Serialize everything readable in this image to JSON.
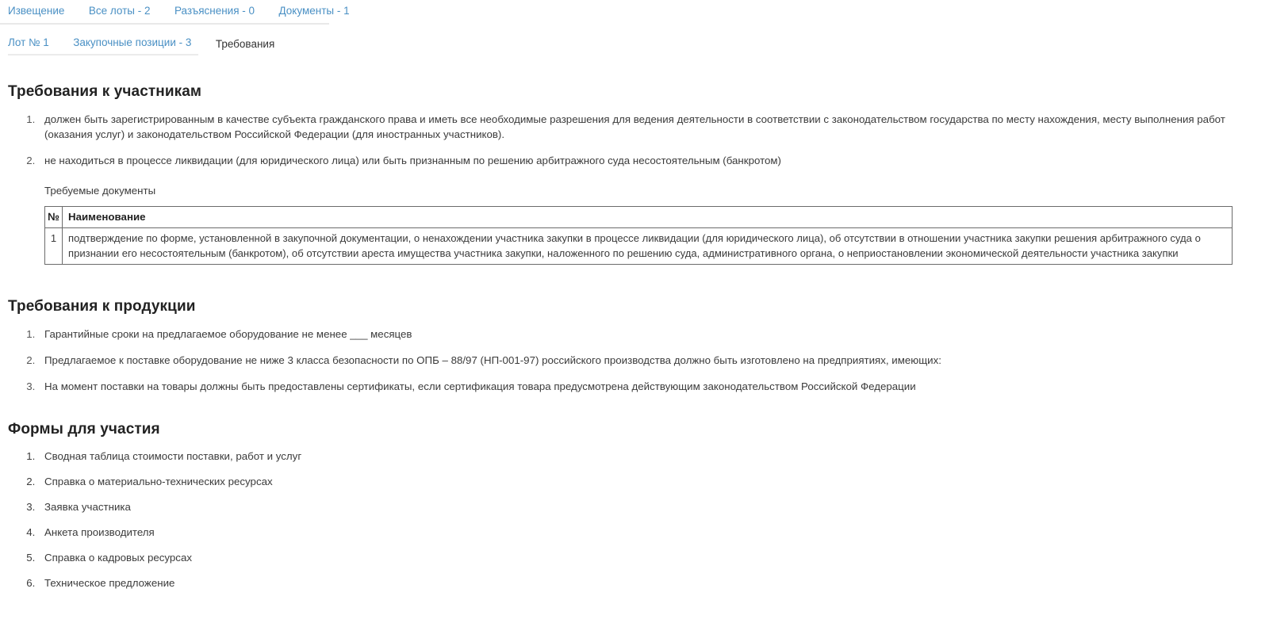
{
  "primary_tabs": [
    {
      "label": "Извещение",
      "active": false
    },
    {
      "label": "Все лоты - 2",
      "active": false
    },
    {
      "label": "Разъяснения - 0",
      "active": false
    },
    {
      "label": "Документы - 1",
      "active": false
    }
  ],
  "secondary_tabs": [
    {
      "label": "Лот № 1",
      "active": false
    },
    {
      "label": "Закупочные позиции - 3",
      "active": false
    },
    {
      "label": "Требования",
      "active": true
    }
  ],
  "sections": {
    "participants": {
      "title": "Требования к участникам",
      "items": [
        "должен быть зарегистрированным в качестве субъекта гражданского права и иметь все необходимые разрешения для ведения деятельности в соответствии с законодательством государства по месту нахождения, месту выполнения работ (оказания услуг) и законодательством Российской Федерации (для иностранных участников).",
        "не находиться в процессе ликвидации (для юридического лица) или быть признанным по решению арбитражного суда несостоятельным (банкротом)"
      ],
      "documents_label": "Требуемые документы",
      "table": {
        "headers": [
          "№",
          "Наименование"
        ],
        "rows": [
          {
            "num": "1",
            "name": "подтверждение по форме, установленной в закупочной документации, о ненахождении участника закупки в процессе ликвидации (для юридического лица), об отсутствии в отношении участника закупки решения арбитражного суда о признании его несостоятельным (банкротом), об отсутствии ареста имущества участника закупки, наложенного по решению суда, административного органа, о неприостановлении экономической деятельности участника закупки"
          }
        ]
      }
    },
    "products": {
      "title": "Требования к продукции",
      "items": [
        "Гарантийные сроки на предлагаемое оборудование не менее ___ месяцев",
        "Предлагаемое к поставке оборудование не ниже 3 класса безопасности по ОПБ – 88/97 (НП-001-97) российского производства должно быть изготовлено на предприятиях, имеющих:",
        "На момент поставки на товары должны быть предоставлены сертификаты, если сертификация товара предусмотрена действующим законодательством Российской Федерации"
      ]
    },
    "forms": {
      "title": "Формы для участия",
      "items": [
        "Сводная таблица стоимости поставки, работ и услуг",
        "Справка о материально-технических ресурсах",
        "Заявка участника",
        "Анкета производителя",
        "Справка о кадровых ресурсах",
        "Техническое предложение"
      ]
    }
  },
  "colors": {
    "link": "#4a90c4",
    "text": "#3b3b3b",
    "heading": "#222222",
    "table_border": "#6b6b6b",
    "rule": "#e9e9e9",
    "active_underline": "#111111"
  }
}
